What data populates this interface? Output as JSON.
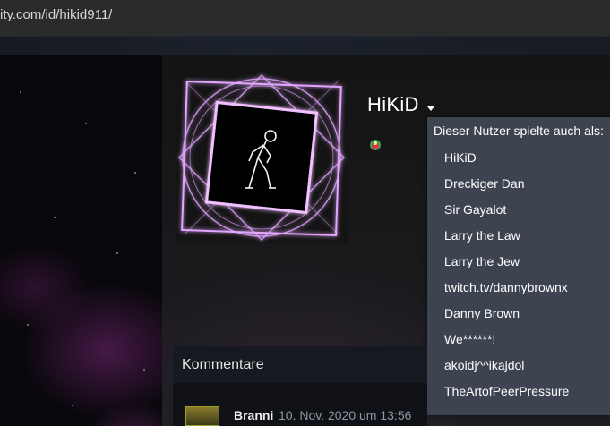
{
  "browser": {
    "url": "ity.com/id/hikid911/"
  },
  "profile": {
    "persona_name": "HiKiD"
  },
  "alias_dropdown": {
    "header": "Dieser Nutzer spielte auch als:",
    "items": [
      "HiKiD",
      "Dreckiger Dan",
      "Sir Gayalot",
      "Larry the Law",
      "Larry the Jew",
      "twitch.tv/dannybrownx",
      "Danny Brown",
      "We******!",
      "akoidj^^ikajdol",
      "TheArtofPeerPressure"
    ]
  },
  "comments": {
    "title": "Kommentare",
    "first": {
      "author": "Branni",
      "date": "10. Nov. 2020 um 13:56"
    }
  },
  "colors": {
    "dropdown_bg": "#3d4450",
    "frame_glow": "#d58cff",
    "page_bg": "#1b1d22"
  }
}
